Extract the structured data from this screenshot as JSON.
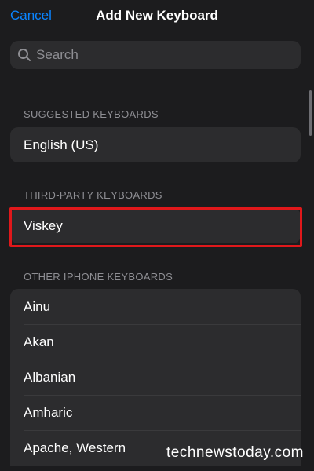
{
  "nav": {
    "cancel_label": "Cancel",
    "title": "Add New Keyboard"
  },
  "search": {
    "placeholder": "Search"
  },
  "suggested": {
    "header": "SUGGESTED KEYBOARDS",
    "items": [
      {
        "label": "English (US)"
      }
    ]
  },
  "third_party": {
    "header": "THIRD-PARTY KEYBOARDS",
    "items": [
      {
        "label": "Viskey"
      }
    ]
  },
  "other": {
    "header": "OTHER IPHONE KEYBOARDS",
    "items": [
      {
        "label": "Ainu"
      },
      {
        "label": "Akan"
      },
      {
        "label": "Albanian"
      },
      {
        "label": "Amharic"
      },
      {
        "label": "Apache, Western"
      }
    ]
  },
  "watermark": "technewstoday.com",
  "colors": {
    "background": "#1c1c1e",
    "cell": "#2c2c2e",
    "accent": "#0a84ff",
    "highlight_box": "#e0181b",
    "secondary_text": "#8e8e93"
  }
}
